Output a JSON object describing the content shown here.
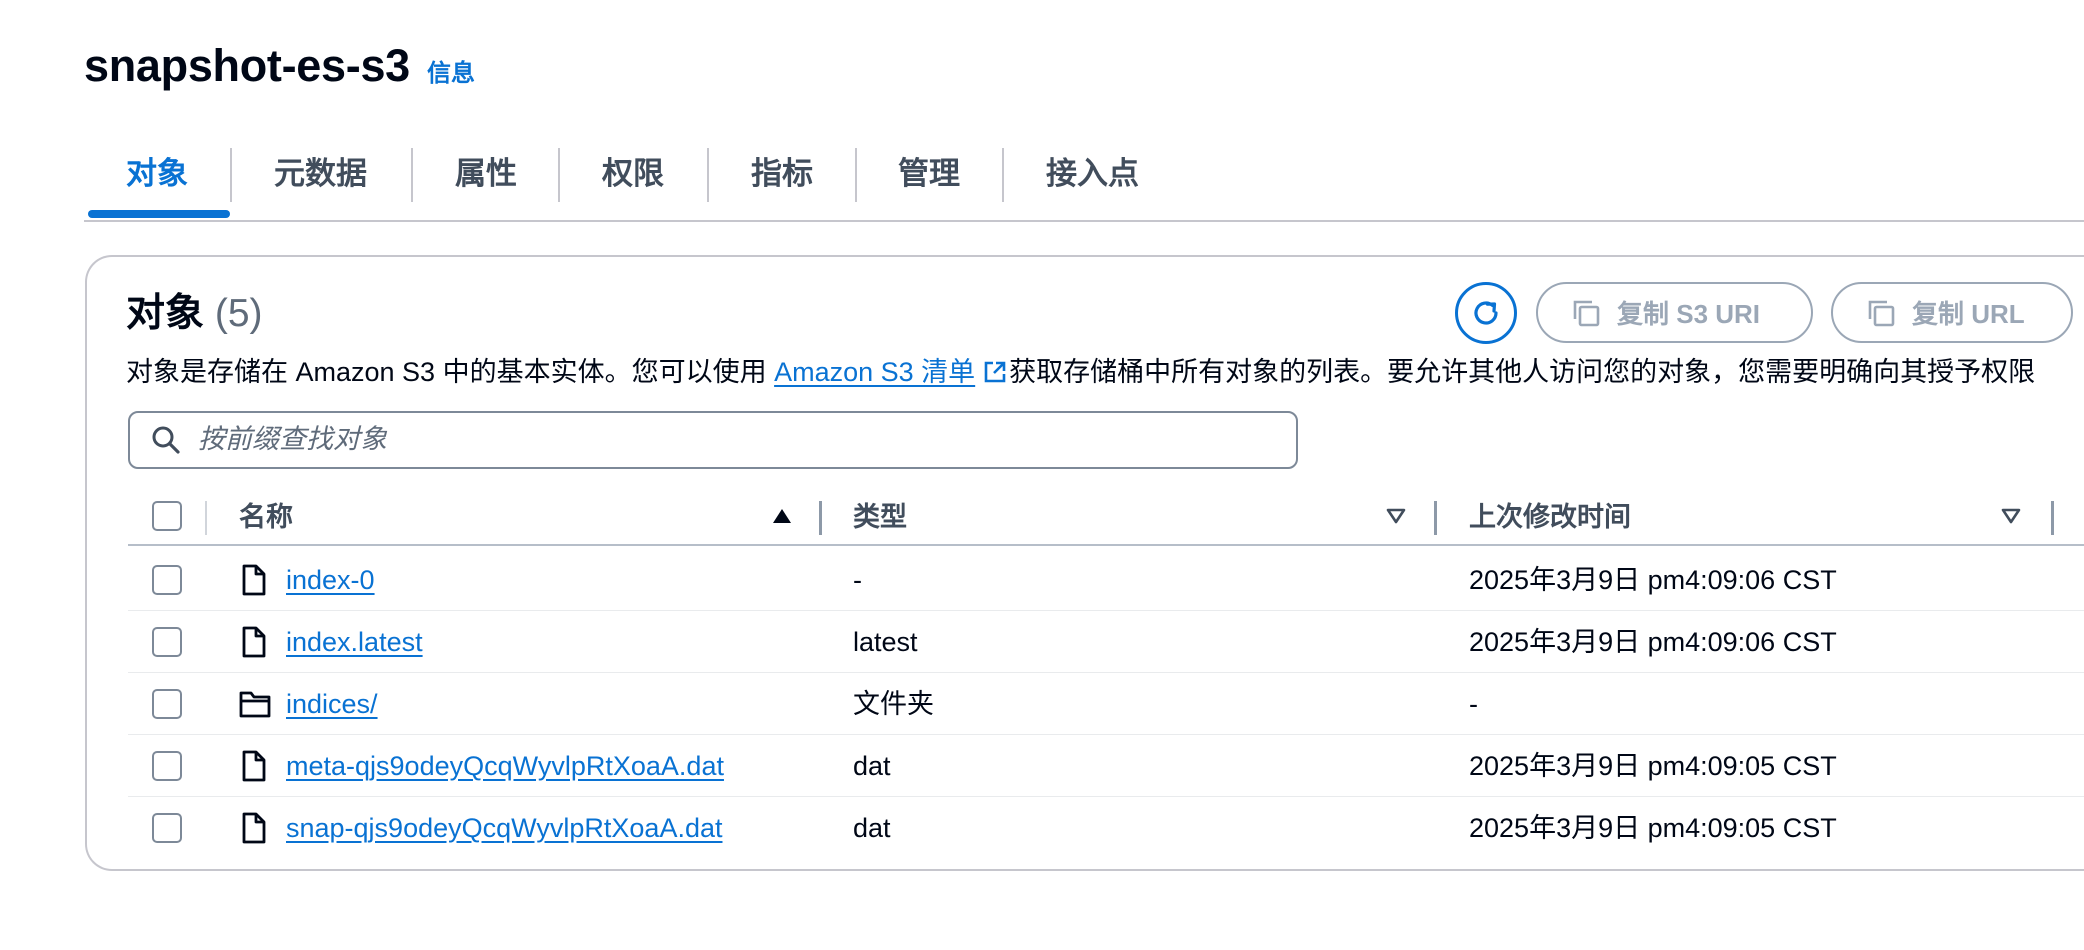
{
  "page": {
    "title": "snapshot-es-s3",
    "info_link": "信息"
  },
  "tabs": [
    {
      "label": "对象",
      "active": true
    },
    {
      "label": "元数据",
      "active": false
    },
    {
      "label": "属性",
      "active": false
    },
    {
      "label": "权限",
      "active": false
    },
    {
      "label": "指标",
      "active": false
    },
    {
      "label": "管理",
      "active": false
    },
    {
      "label": "接入点",
      "active": false
    }
  ],
  "objects_panel": {
    "heading": "对象",
    "count": "(5)",
    "refresh_icon": "refresh-icon",
    "copy_s3_uri_label": "复制 S3 URI",
    "copy_url_label": "复制 URL",
    "copy_icon": "copy-icon",
    "description": {
      "before": "对象是存储在 Amazon S3 中的基本实体。您可以使用 ",
      "link": "Amazon S3 清单",
      "link_icon": "external-link-icon",
      "after": "获取存储桶中所有对象的列表。要允许其他人访问您的对象，您需要明确向其授予权限"
    },
    "search": {
      "placeholder": "按前缀查找对象",
      "value": "",
      "icon": "search-icon"
    },
    "columns": [
      {
        "label": "名称",
        "sort": "ascending"
      },
      {
        "label": "类型",
        "sort": "none"
      },
      {
        "label": "上次修改时间",
        "sort": "none"
      }
    ],
    "rows": [
      {
        "icon": "file-icon",
        "name": "index-0",
        "type": "-",
        "last_modified": "2025年3月9日 pm4:09:06 CST"
      },
      {
        "icon": "file-icon",
        "name": "index.latest",
        "type": "latest",
        "last_modified": "2025年3月9日 pm4:09:06 CST"
      },
      {
        "icon": "folder-icon",
        "name": "indices/",
        "type": "文件夹",
        "last_modified": "-"
      },
      {
        "icon": "file-icon",
        "name": "meta-qjs9odeyQcqWyvlpRtXoaA.dat",
        "type": "dat",
        "last_modified": "2025年3月9日 pm4:09:05 CST"
      },
      {
        "icon": "file-icon",
        "name": "snap-qjs9odeyQcqWyvlpRtXoaA.dat",
        "type": "dat",
        "last_modified": "2025年3月9日 pm4:09:05 CST"
      }
    ]
  },
  "colors": {
    "accent": "#0972d3",
    "text": "#000716",
    "muted": "#5f6b7a",
    "border": "#c6c6cd",
    "disabled": "#9ba7b6"
  }
}
